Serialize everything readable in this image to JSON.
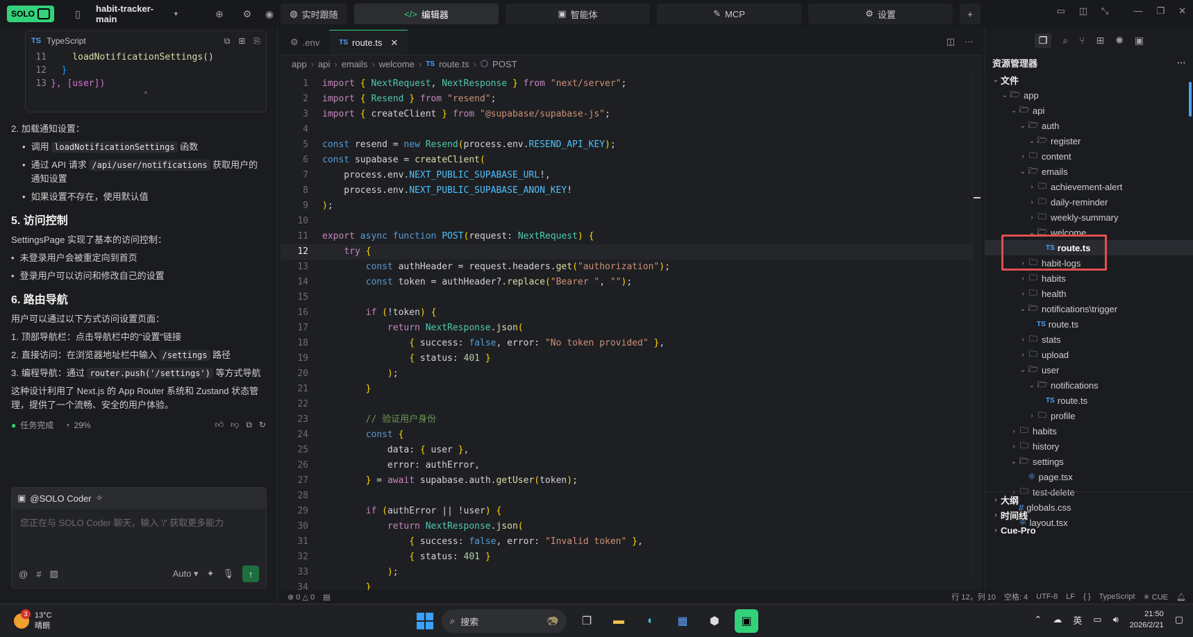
{
  "topbar": {
    "brand": "SOLO",
    "project": "habit-tracker-main",
    "modes": [
      {
        "label": "实时跟随",
        "icon": "globe-icon"
      },
      {
        "label": "编辑器",
        "icon": "code-icon"
      },
      {
        "label": "智能体",
        "icon": "agent-icon"
      },
      {
        "label": "MCP",
        "icon": "tool-icon"
      },
      {
        "label": "设置",
        "icon": "gear-icon"
      }
    ],
    "add": "+"
  },
  "chat": {
    "codecard": {
      "lang": "TypeScript",
      "lines": [
        {
          "n": "11",
          "t": "    loadNotificationSettings()"
        },
        {
          "n": "12",
          "t": "  }"
        },
        {
          "n": "13",
          "t": "}, [user])"
        }
      ],
      "collapse": "^"
    },
    "step2_num": "2.",
    "step2_title": "加载通知设置：",
    "step2_b1_pre": "调用",
    "step2_b1_code": "loadNotificationSettings",
    "step2_b1_post": "函数",
    "step2_b2_pre": "通过 API 请求",
    "step2_b2_code": "/api/user/notifications",
    "step2_b2_post": "获取用户的通知设置",
    "step2_b3": "如果设置不存在，使用默认值",
    "h5": "5. 访问控制",
    "p5": "SettingsPage 实现了基本的访问控制：",
    "b5_1": "未登录用户会被重定向到首页",
    "b5_2": "登录用户可以访问和修改自己的设置",
    "h6": "6. 路由导航",
    "p6": "用户可以通过以下方式访问设置页面：",
    "n1_num": "1.",
    "n1": "顶部导航栏：点击导航栏中的\"设置\"链接",
    "n2_num": "2.",
    "n2_pre": "直接访问：在浏览器地址栏中输入",
    "n2_code": "/settings",
    "n2_post": "路径",
    "n3_num": "3.",
    "n3_pre": "编程导航：通过",
    "n3_code": "router.push('/settings')",
    "n3_post": "等方式导航",
    "summary": "这种设计利用了 Next.js 的 App Router 系统和 Zustand 状态管理，提供了一个流畅、安全的用户体验。",
    "task_done": "任务完成",
    "progress": "29%",
    "input_agent": "@SOLO Coder",
    "input_placeholder": "您正在与 SOLO Coder 聊天，输入 '/' 获取更多能力",
    "at": "@",
    "hash": "#",
    "model": "Auto"
  },
  "editor": {
    "tabs": [
      {
        "label": ".env"
      },
      {
        "label": "route.ts"
      }
    ],
    "breadcrumb": [
      "app",
      "api",
      "emails",
      "welcome",
      "route.ts",
      "POST"
    ],
    "current_line": 12,
    "lines": [
      "import { NextRequest, NextResponse } from \"next/server\";",
      "import { Resend } from \"resend\";",
      "import { createClient } from \"@supabase/supabase-js\";",
      "",
      "const resend = new Resend(process.env.RESEND_API_KEY);",
      "const supabase = createClient(",
      "    process.env.NEXT_PUBLIC_SUPABASE_URL!,",
      "    process.env.NEXT_PUBLIC_SUPABASE_ANON_KEY!",
      ");",
      "",
      "export async function POST(request: NextRequest) {",
      "    try {",
      "        const authHeader = request.headers.get(\"authorization\");",
      "        const token = authHeader?.replace(\"Bearer \", \"\");",
      "",
      "        if (!token) {",
      "            return NextResponse.json(",
      "                { success: false, error: \"No token provided\" },",
      "                { status: 401 }",
      "            );",
      "        }",
      "",
      "        // 验证用户身份",
      "        const {",
      "            data: { user },",
      "            error: authError,",
      "        } = await supabase.auth.getUser(token);",
      "",
      "        if (authError || !user) {",
      "            return NextResponse.json(",
      "                { success: false, error: \"Invalid token\" },",
      "                { status: 401 }",
      "            );",
      "        }"
    ]
  },
  "status": {
    "errors": "0",
    "warnings": "0",
    "position": "行 12，列 10",
    "indent": "空格: 4",
    "encoding": "UTF-8",
    "eol": "LF",
    "braces": "{ }",
    "language": "TypeScript",
    "cue": "CUE"
  },
  "explorer": {
    "title": "资源管理器",
    "more": "···",
    "section_files": "文件",
    "tree": [
      {
        "d": 1,
        "label": "app",
        "type": "folder",
        "open": true
      },
      {
        "d": 2,
        "label": "api",
        "type": "folder",
        "open": true
      },
      {
        "d": 3,
        "label": "auth",
        "type": "folder",
        "open": true
      },
      {
        "d": 4,
        "label": "register",
        "type": "folder",
        "open": true
      },
      {
        "d": 3,
        "label": "content",
        "type": "folder",
        "open": false
      },
      {
        "d": 3,
        "label": "emails",
        "type": "folder",
        "open": true
      },
      {
        "d": 4,
        "label": "achievement-alert",
        "type": "folder",
        "open": false
      },
      {
        "d": 4,
        "label": "daily-reminder",
        "type": "folder",
        "open": false
      },
      {
        "d": 4,
        "label": "weekly-summary",
        "type": "folder",
        "open": false
      },
      {
        "d": 4,
        "label": "welcome",
        "type": "folder",
        "open": true
      },
      {
        "d": 5,
        "label": "route.ts",
        "type": "ts",
        "selected": true
      },
      {
        "d": 3,
        "label": "habit-logs",
        "type": "folder",
        "open": false
      },
      {
        "d": 3,
        "label": "habits",
        "type": "folder",
        "open": false
      },
      {
        "d": 3,
        "label": "health",
        "type": "folder",
        "open": false
      },
      {
        "d": 3,
        "label": "notifications\\trigger",
        "type": "folder",
        "open": true
      },
      {
        "d": 4,
        "label": "route.ts",
        "type": "ts"
      },
      {
        "d": 3,
        "label": "stats",
        "type": "folder",
        "open": false
      },
      {
        "d": 3,
        "label": "upload",
        "type": "folder",
        "open": false
      },
      {
        "d": 3,
        "label": "user",
        "type": "folder",
        "open": true
      },
      {
        "d": 4,
        "label": "notifications",
        "type": "folder",
        "open": true
      },
      {
        "d": 5,
        "label": "route.ts",
        "type": "ts"
      },
      {
        "d": 4,
        "label": "profile",
        "type": "folder",
        "open": false
      },
      {
        "d": 2,
        "label": "habits",
        "type": "folder",
        "open": false
      },
      {
        "d": 2,
        "label": "history",
        "type": "folder",
        "open": false
      },
      {
        "d": 2,
        "label": "settings",
        "type": "folder",
        "open": true
      },
      {
        "d": 3,
        "label": "page.tsx",
        "type": "tsx"
      },
      {
        "d": 2,
        "label": "test-delete",
        "type": "folder",
        "open": false
      },
      {
        "d": 2,
        "label": "globals.css",
        "type": "css"
      },
      {
        "d": 2,
        "label": "layout.tsx",
        "type": "tsx"
      }
    ],
    "sections": [
      "大纲",
      "时间线",
      "Cue-Pro"
    ]
  },
  "taskbar": {
    "weather_badge": "3",
    "temp": "13°C",
    "weather": "晴朗",
    "search": "搜索",
    "ime": "英",
    "time": "21:50",
    "date": "2026/2/21"
  }
}
